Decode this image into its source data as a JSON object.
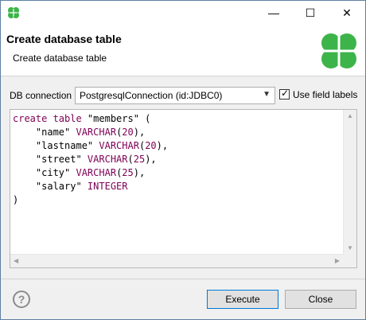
{
  "window": {
    "minimize_glyph": "—",
    "maximize_glyph": "☐",
    "close_glyph": "✕"
  },
  "header": {
    "title": "Create database table",
    "subtitle": "Create database table"
  },
  "connection": {
    "label": "DB connection",
    "selected": "PostgresqlConnection (id:JDBC0)",
    "use_field_labels": {
      "label": "Use field labels",
      "checked": true,
      "check_glyph": "✓"
    }
  },
  "editor": {
    "lines": [
      [
        {
          "t": "create table ",
          "c": "kw"
        },
        {
          "t": "\"members\" (",
          "c": "str"
        }
      ],
      [
        {
          "t": "    \"name\" ",
          "c": "str"
        },
        {
          "t": "VARCHAR",
          "c": "kw"
        },
        {
          "t": "(",
          "c": "str"
        },
        {
          "t": "20",
          "c": "num"
        },
        {
          "t": "),",
          "c": "str"
        }
      ],
      [
        {
          "t": "    \"lastname\" ",
          "c": "str"
        },
        {
          "t": "VARCHAR",
          "c": "kw"
        },
        {
          "t": "(",
          "c": "str"
        },
        {
          "t": "20",
          "c": "num"
        },
        {
          "t": "),",
          "c": "str"
        }
      ],
      [
        {
          "t": "    \"street\" ",
          "c": "str"
        },
        {
          "t": "VARCHAR",
          "c": "kw"
        },
        {
          "t": "(",
          "c": "str"
        },
        {
          "t": "25",
          "c": "num"
        },
        {
          "t": "),",
          "c": "str"
        }
      ],
      [
        {
          "t": "    \"city\" ",
          "c": "str"
        },
        {
          "t": "VARCHAR",
          "c": "kw"
        },
        {
          "t": "(",
          "c": "str"
        },
        {
          "t": "25",
          "c": "num"
        },
        {
          "t": "),",
          "c": "str"
        }
      ],
      [
        {
          "t": "    \"salary\" ",
          "c": "str"
        },
        {
          "t": "INTEGER",
          "c": "kw"
        }
      ],
      [
        {
          "t": ")",
          "c": "str"
        }
      ]
    ]
  },
  "footer": {
    "help_glyph": "?",
    "execute_label": "Execute",
    "close_label": "Close"
  },
  "colors": {
    "keyword": "#7f0055",
    "logo_green": "#3cb44a",
    "focus_border": "#0078d7"
  }
}
